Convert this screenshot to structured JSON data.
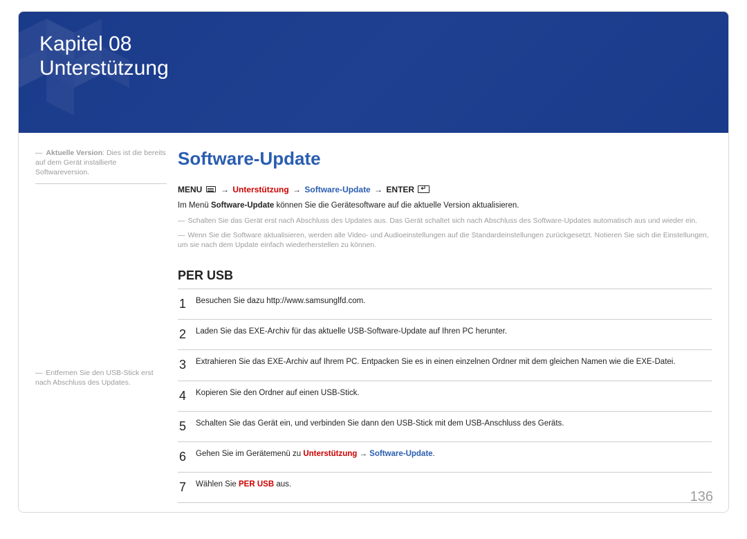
{
  "banner": {
    "chapter_line": "Kapitel 08",
    "chapter_title": "Unterstützung"
  },
  "sidebar": {
    "note1_prefix": "―",
    "note1_label": "Aktuelle Version",
    "note1_text": ": Dies ist die bereits auf dem Gerät installierte Softwareversion.",
    "note2_prefix": "―",
    "note2_text": "Entfernen Sie den USB-Stick erst nach Abschluss des Updates."
  },
  "main": {
    "section_title": "Software-Update",
    "breadcrumb": {
      "menu": "MENU",
      "support": "Unterstützung",
      "software_update": "Software-Update",
      "enter": "ENTER"
    },
    "intro_prefix": "Im Menü ",
    "intro_bold": "Software-Update",
    "intro_suffix": " können Sie die Gerätesoftware auf die aktuelle Version aktualisieren.",
    "foot1": "Schalten Sie das Gerät erst nach Abschluss des Updates aus. Das Gerät schaltet sich nach Abschluss des Software-Updates automatisch aus und wieder ein.",
    "foot2": "Wenn Sie die Software aktualisieren, werden alle Video- und Audioeinstellungen auf die Standardeinstellungen zurückgesetzt. Notieren Sie sich die Einstellungen, um sie nach dem Update einfach wiederherstellen zu können.",
    "sub_title": "PER USB",
    "steps": [
      {
        "n": "1",
        "text": "Besuchen Sie dazu http://www.samsunglfd.com."
      },
      {
        "n": "2",
        "text": "Laden Sie das EXE-Archiv für das aktuelle USB-Software-Update auf Ihren PC herunter."
      },
      {
        "n": "3",
        "text": "Extrahieren Sie das EXE-Archiv auf Ihrem PC. Entpacken Sie es in einen einzelnen Ordner mit dem gleichen Namen wie die EXE-Datei."
      },
      {
        "n": "4",
        "text": "Kopieren Sie den Ordner auf einen USB-Stick."
      },
      {
        "n": "5",
        "text": "Schalten Sie das Gerät ein, und verbinden Sie dann den USB-Stick mit dem USB-Anschluss des Geräts."
      },
      {
        "n": "6",
        "prefix": "Gehen Sie im Gerätemenü zu ",
        "red": "Unterstützung",
        "arrow": " → ",
        "blue": "Software-Update",
        "suffix": "."
      },
      {
        "n": "7",
        "prefix": "Wählen Sie ",
        "red": "PER USB",
        "suffix": " aus."
      }
    ]
  },
  "page_number": "136"
}
